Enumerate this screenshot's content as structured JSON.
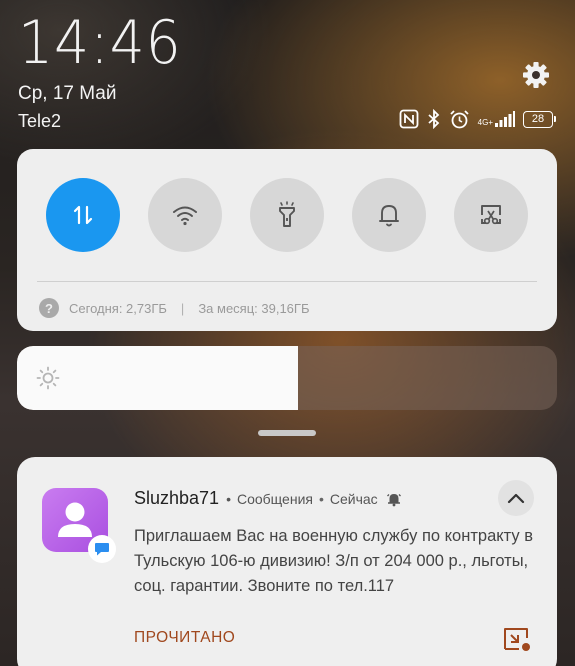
{
  "status": {
    "time": "14:46",
    "date": "Ср, 17 Май",
    "carrier": "Tele2",
    "network_label": "4G+",
    "battery": "28"
  },
  "icons": {
    "settings": "gear-icon",
    "nfc": "nfc-icon",
    "bluetooth": "bluetooth-icon",
    "alarm": "alarm-icon",
    "signal": "signal-icon"
  },
  "quick_settings": {
    "tiles": [
      {
        "name": "mobile-data",
        "icon": "data-arrows-icon",
        "active": true
      },
      {
        "name": "wifi",
        "icon": "wifi-icon",
        "active": false
      },
      {
        "name": "flashlight",
        "icon": "flashlight-icon",
        "active": false
      },
      {
        "name": "sound",
        "icon": "bell-icon",
        "active": false
      },
      {
        "name": "screenshot",
        "icon": "screenshot-icon",
        "active": false
      }
    ],
    "data_today": "Сегодня: 2,73ГБ",
    "separator": "|",
    "data_month": "За месяц: 39,16ГБ"
  },
  "brightness": {
    "level": 0.52
  },
  "notification": {
    "sender": "Sluzhba71",
    "app": "Сообщения",
    "time": "Сейчас",
    "dot": "•",
    "body": "Приглашаем Вас на военную службу по контракту в Тульскую 106-ю дивизию! З/п от 204 000 р., льготы, соц. гарантии. Звоните по тел.117",
    "action": "ПРОЧИТАНО"
  },
  "colors": {
    "accent": "#1a97f0",
    "action": "#a0481e",
    "app_icon": "#b862e8"
  }
}
